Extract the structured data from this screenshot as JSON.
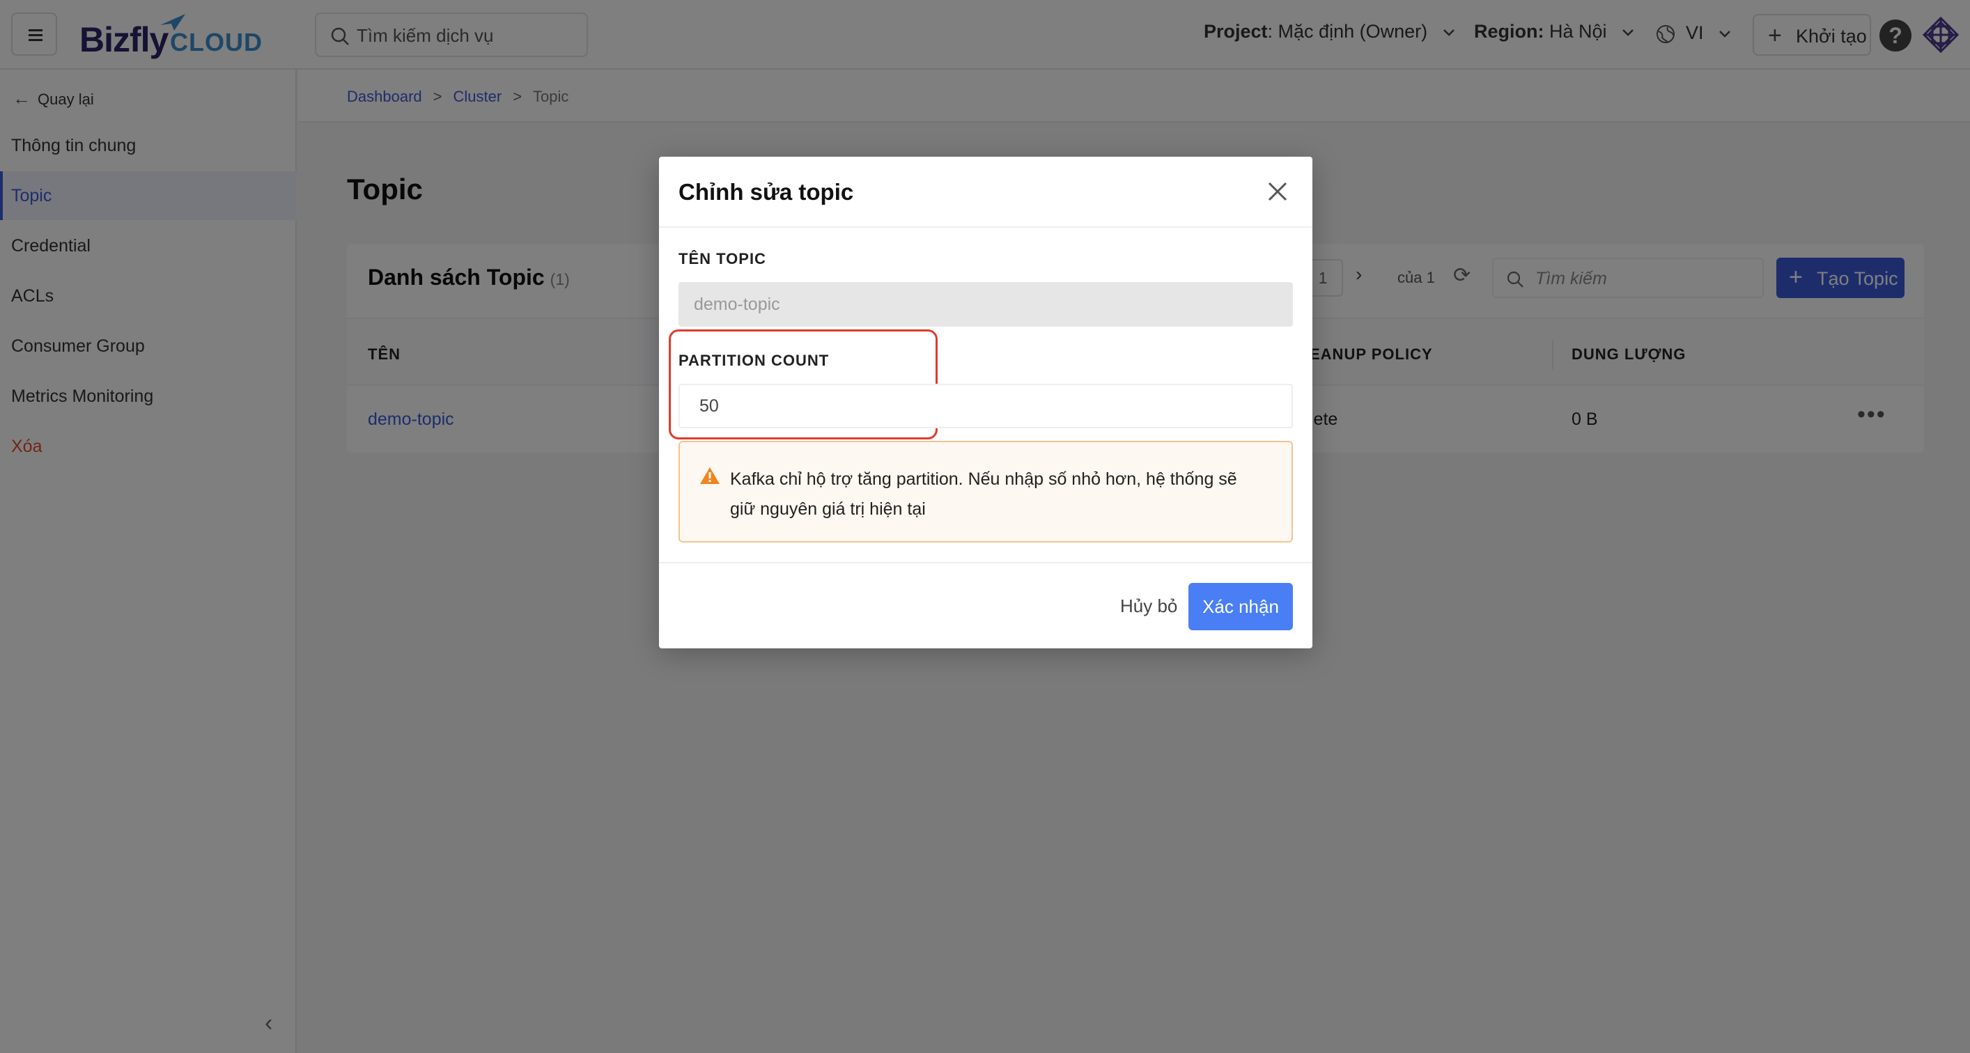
{
  "header": {
    "logo_text": "Bizfly",
    "logo_sub": "CLOUD",
    "search_placeholder": "Tìm kiếm dịch vụ",
    "project_label": "Project",
    "project_value": ": Mặc định (Owner)",
    "region_label": "Region:",
    "region_value": "Hà Nội",
    "language": "VI",
    "create_label": "Khởi tạo",
    "help": "?"
  },
  "sidebar": {
    "back_label": "Quay lại",
    "items": [
      {
        "label": "Thông tin chung"
      },
      {
        "label": "Topic"
      },
      {
        "label": "Credential"
      },
      {
        "label": "ACLs"
      },
      {
        "label": "Consumer Group"
      },
      {
        "label": "Metrics Monitoring"
      },
      {
        "label": "Xóa"
      }
    ],
    "active_index": 1
  },
  "breadcrumb": {
    "items": [
      "Dashboard",
      "Cluster",
      "Topic"
    ],
    "separator": ">"
  },
  "page": {
    "title": "Topic"
  },
  "card": {
    "title": "Danh sách Topic",
    "count": "(1)",
    "pager_page": "1",
    "pager_of": "của 1",
    "search_placeholder": "Tìm kiếm",
    "create_label": "Tạo Topic",
    "columns": [
      "TÊN",
      "EANUP POLICY",
      "DUNG LƯỢNG"
    ],
    "rows": [
      {
        "name": "demo-topic",
        "cleanup_policy": "lete",
        "size": "0 B"
      }
    ],
    "row_actions": "•••"
  },
  "modal": {
    "title": "Chỉnh sửa topic",
    "topic_name_label": "TÊN TOPIC",
    "topic_name_value": "demo-topic",
    "partition_label": "PARTITION COUNT",
    "partition_value": "50",
    "warning": "Kafka chỉ hộ trợ tăng partition. Nếu nhập số nhỏ hơn, hệ thống sẽ giữ nguyên giá trị hiện tại",
    "cancel_label": "Hủy bỏ",
    "confirm_label": "Xác nhận"
  },
  "colors": {
    "primary": "#3a5bd8",
    "confirm": "#4a7ef5",
    "danger": "#e24a2c",
    "highlight": "#e13a2c",
    "warning_border": "#f4c38f",
    "warning_icon": "#f0841d"
  },
  "icons": [
    "menu-icon",
    "search-icon",
    "chevron-down-icon",
    "globe-icon",
    "plus-icon",
    "help-icon",
    "arrow-left-icon",
    "chevron-right-icon",
    "refresh-icon",
    "close-icon",
    "warning-icon",
    "collapse-icon"
  ]
}
